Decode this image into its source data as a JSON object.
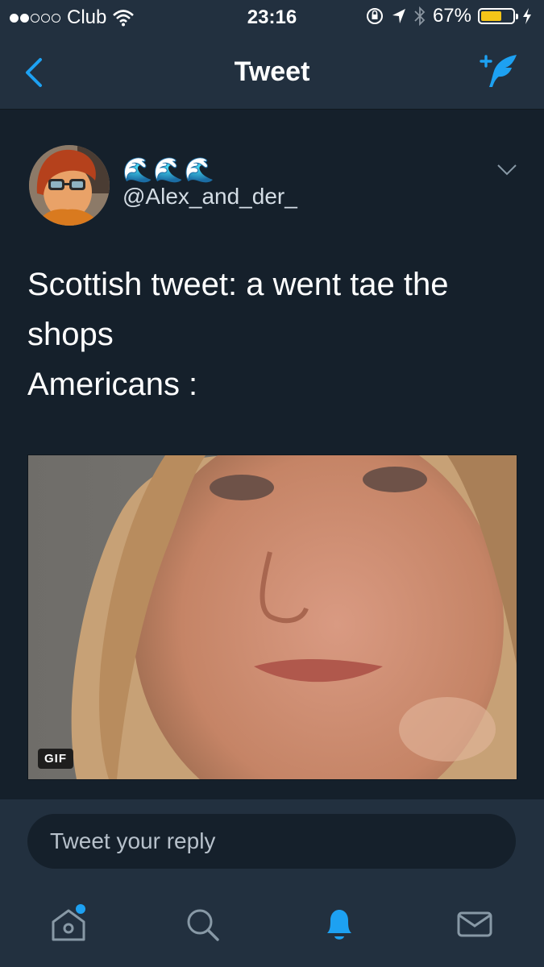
{
  "status_bar": {
    "carrier": "Club",
    "time": "23:16",
    "battery_text": "67%",
    "battery_level": 0.67,
    "icons": [
      "signal-dots-icon",
      "wifi-icon",
      "orientation-lock-icon",
      "location-arrow-icon",
      "bluetooth-icon",
      "battery-icon",
      "charging-bolt-icon"
    ]
  },
  "nav": {
    "title": "Tweet",
    "back_icon": "back-chevron-icon",
    "compose_icon": "compose-tweet-icon"
  },
  "tweet": {
    "display_name": "🌊🌊🌊",
    "handle": "@Alex_and_der_",
    "text_lines": [
      "Scottish tweet: a went tae the",
      "shops",
      "Americans :"
    ],
    "media_badge": "GIF"
  },
  "reply": {
    "placeholder": "Tweet your reply"
  },
  "tab_bar": {
    "tabs": [
      "home-icon",
      "search-icon",
      "notifications-bell-icon",
      "messages-envelope-icon"
    ],
    "active": "notifications-bell-icon"
  },
  "colors": {
    "background": "#15202b",
    "bar": "#22303f",
    "accent": "#1da1f2",
    "battery": "#f5c518"
  }
}
